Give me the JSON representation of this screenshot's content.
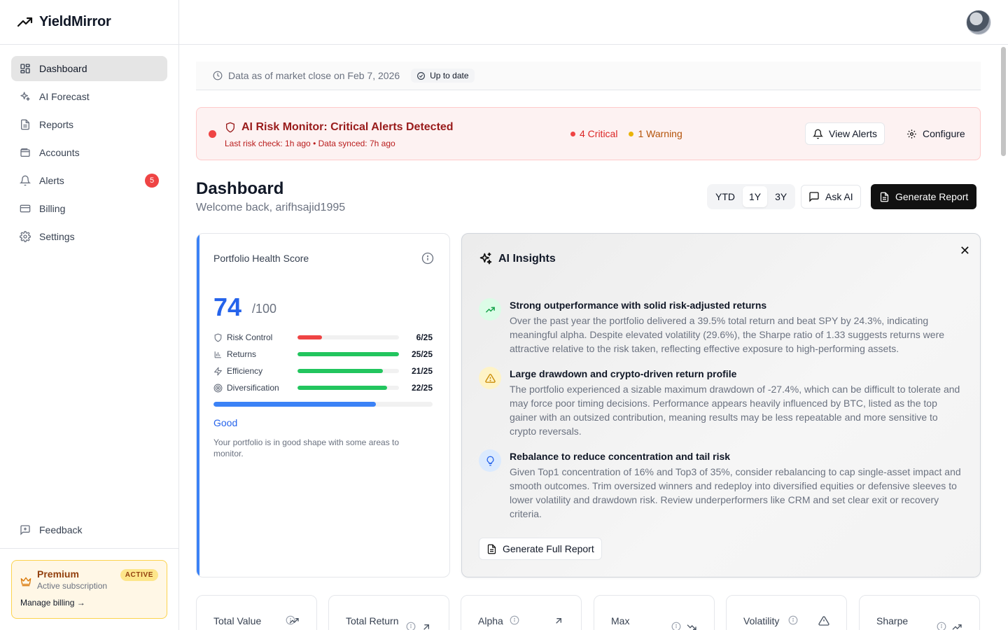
{
  "brand": {
    "name": "YieldMirror"
  },
  "sidebar": {
    "items": [
      {
        "label": "Dashboard",
        "icon": "dashboard-icon"
      },
      {
        "label": "AI Forecast",
        "icon": "sparkles-icon"
      },
      {
        "label": "Reports",
        "icon": "file-icon"
      },
      {
        "label": "Accounts",
        "icon": "wallet-icon"
      },
      {
        "label": "Alerts",
        "icon": "bell-icon",
        "badge": "5"
      },
      {
        "label": "Billing",
        "icon": "credit-card-icon"
      },
      {
        "label": "Settings",
        "icon": "gear-icon"
      }
    ],
    "feedback": "Feedback",
    "premium": {
      "title": "Premium",
      "subtitle": "Active subscription",
      "status": "ACTIVE",
      "link": "Manage billing →"
    }
  },
  "status": {
    "data_as_of": "Data as of market close on Feb 7, 2026",
    "up_to_date": "Up to date"
  },
  "alert_banner": {
    "title": "AI Risk Monitor: Critical Alerts Detected",
    "subtitle": "Last risk check: 1h ago • Data synced: 7h ago",
    "critical": "4 Critical",
    "warning": "1 Warning",
    "view_alerts": "View Alerts",
    "configure": "Configure",
    "colors": {
      "critical": "#ef4444",
      "warning": "#eab308"
    }
  },
  "header": {
    "title": "Dashboard",
    "welcome": "Welcome back, arifhsajid1995",
    "ranges": [
      "YTD",
      "1Y",
      "3Y"
    ],
    "selected_range": "1Y",
    "ask_ai": "Ask AI",
    "generate_report": "Generate Report"
  },
  "health": {
    "title": "Portfolio Health Score",
    "score": "74",
    "max": "/100",
    "metrics": [
      {
        "label": "Risk Control",
        "value": "6/25",
        "fraction": 0.24,
        "color": "#ef4444",
        "icon": "shield-icon"
      },
      {
        "label": "Returns",
        "value": "25/25",
        "fraction": 1.0,
        "color": "#22c55e",
        "icon": "bar-chart-icon"
      },
      {
        "label": "Efficiency",
        "value": "21/25",
        "fraction": 0.84,
        "color": "#22c55e",
        "icon": "lightning-icon"
      },
      {
        "label": "Diversification",
        "value": "22/25",
        "fraction": 0.88,
        "color": "#22c55e",
        "icon": "target-icon"
      }
    ],
    "overall_fraction": 0.74,
    "rating": "Good",
    "description": "Your portfolio is in good shape with some areas to monitor."
  },
  "insights": {
    "title": "AI Insights",
    "items": [
      {
        "title": "Strong outperformance with solid risk-adjusted returns",
        "body": "Over the past year the portfolio delivered a 39.5% total return and beat SPY by 24.3%, indicating meaningful alpha. Despite elevated volatility (29.6%), the Sharpe ratio of 1.33 suggests returns were attractive relative to the risk taken, reflecting effective exposure to high-performing assets.",
        "icon": "trending-up-icon"
      },
      {
        "title": "Large drawdown and crypto-driven return profile",
        "body": "The portfolio experienced a sizable maximum drawdown of -27.4%, which can be difficult to tolerate and may force poor timing decisions. Performance appears heavily influenced by BTC, listed as the top gainer with an outsized contribution, meaning results may be less repeatable and more sensitive to crypto reversals.",
        "icon": "warning-icon"
      },
      {
        "title": "Rebalance to reduce concentration and tail risk",
        "body": "Given Top1 concentration of 16% and Top3 of 35%, consider rebalancing to cap single-asset impact and smooth outcomes. Trim oversized winners and redeploy into diversified equities or defensive sleeves to lower volatility and drawdown risk. Review underperformers like CRM and set clear exit or recovery criteria.",
        "icon": "lightbulb-icon"
      }
    ],
    "full_report": "Generate Full Report"
  },
  "stats": [
    {
      "label": "Total Value",
      "icon": "trending-up-icon"
    },
    {
      "label": "Total Return",
      "icon": "arrow-up-right-icon"
    },
    {
      "label": "Alpha",
      "icon": "arrow-up-right-icon"
    },
    {
      "label": "Max Drawdown",
      "icon": "trending-down-icon"
    },
    {
      "label": "Volatility",
      "icon": "warning-icon"
    },
    {
      "label": "Sharpe Ratio",
      "icon": "trending-up-icon"
    }
  ]
}
